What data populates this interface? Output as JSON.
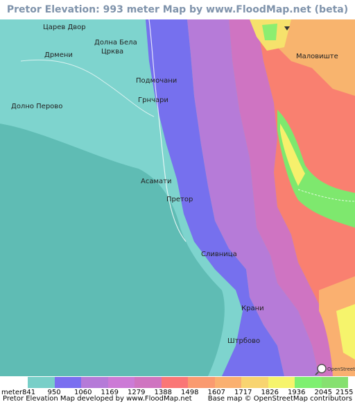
{
  "title": "Pretor Elevation: 993 meter Map by www.FloodMap.net (beta)",
  "places": [
    {
      "name": "Царев Двор",
      "key": "carev-dvor"
    },
    {
      "name": "Долна Бела",
      "key": "dolna-bela-1"
    },
    {
      "name": "Црква",
      "key": "dolna-bela-2"
    },
    {
      "name": "Дрмени",
      "key": "drmeni"
    },
    {
      "name": "Подмочани",
      "key": "podmochani"
    },
    {
      "name": "Грнчари",
      "key": "grnchari"
    },
    {
      "name": "Долно Перово",
      "key": "dolno-perovo"
    },
    {
      "name": "Асамати",
      "key": "asamati"
    },
    {
      "name": "Претор",
      "key": "pretor"
    },
    {
      "name": "Маловиште",
      "key": "malovishte"
    },
    {
      "name": "Сливница",
      "key": "slivnica"
    },
    {
      "name": "Крани",
      "key": "krani"
    },
    {
      "name": "Штрбово",
      "key": "shtrbovo"
    }
  ],
  "legend": {
    "unit_label": "meter",
    "values": [
      "841",
      "950",
      "1060",
      "1169",
      "1279",
      "1388",
      "1498",
      "1607",
      "1717",
      "1826",
      "1936",
      "2045",
      "2155"
    ],
    "colors": [
      "#78cfc8",
      "#7a6ff0",
      "#b57ad8",
      "#cc7ad6",
      "#cf74c0",
      "#fa7676",
      "#fa9a70",
      "#fab070",
      "#f8d470",
      "#f6f46c",
      "#7ef070",
      "#86e070"
    ]
  },
  "footer": {
    "left": "Pretor Elevation Map developed by www.FloodMap.net",
    "right": "Base map © OpenStreetMap contributors"
  },
  "osm_badge": "OpenStreetMap"
}
